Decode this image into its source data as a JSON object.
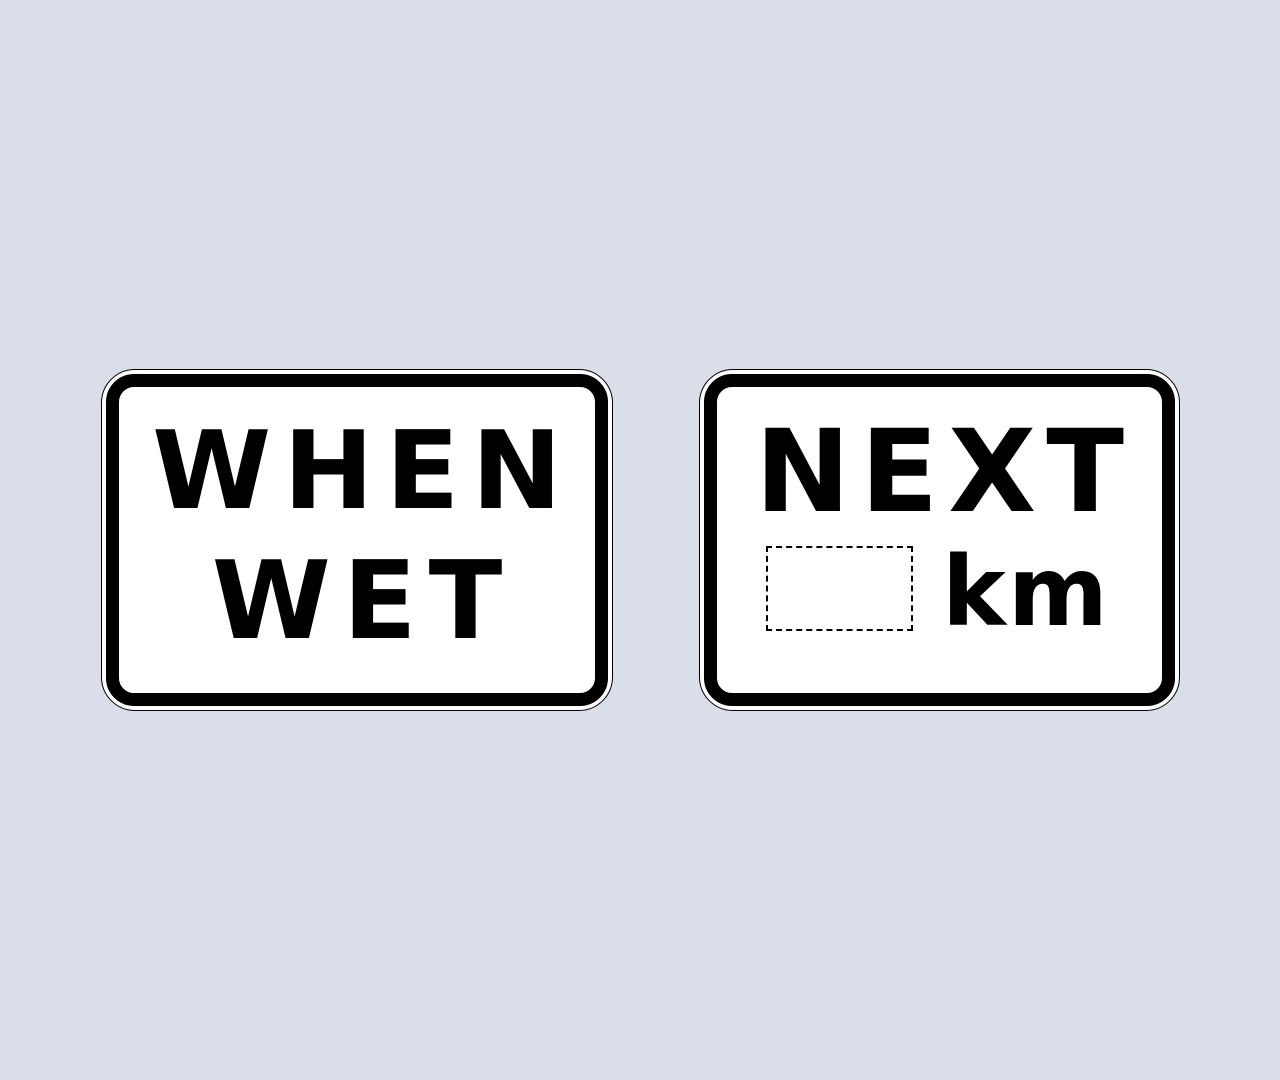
{
  "signs": [
    {
      "lines": [
        "WHEN",
        "WET"
      ]
    },
    {
      "line1": "NEXT",
      "distance_value": "",
      "unit": "km"
    }
  ],
  "colors": {
    "background": "#d9dee8",
    "sign_face": "#ffffff",
    "legend_and_border": "#000000"
  }
}
